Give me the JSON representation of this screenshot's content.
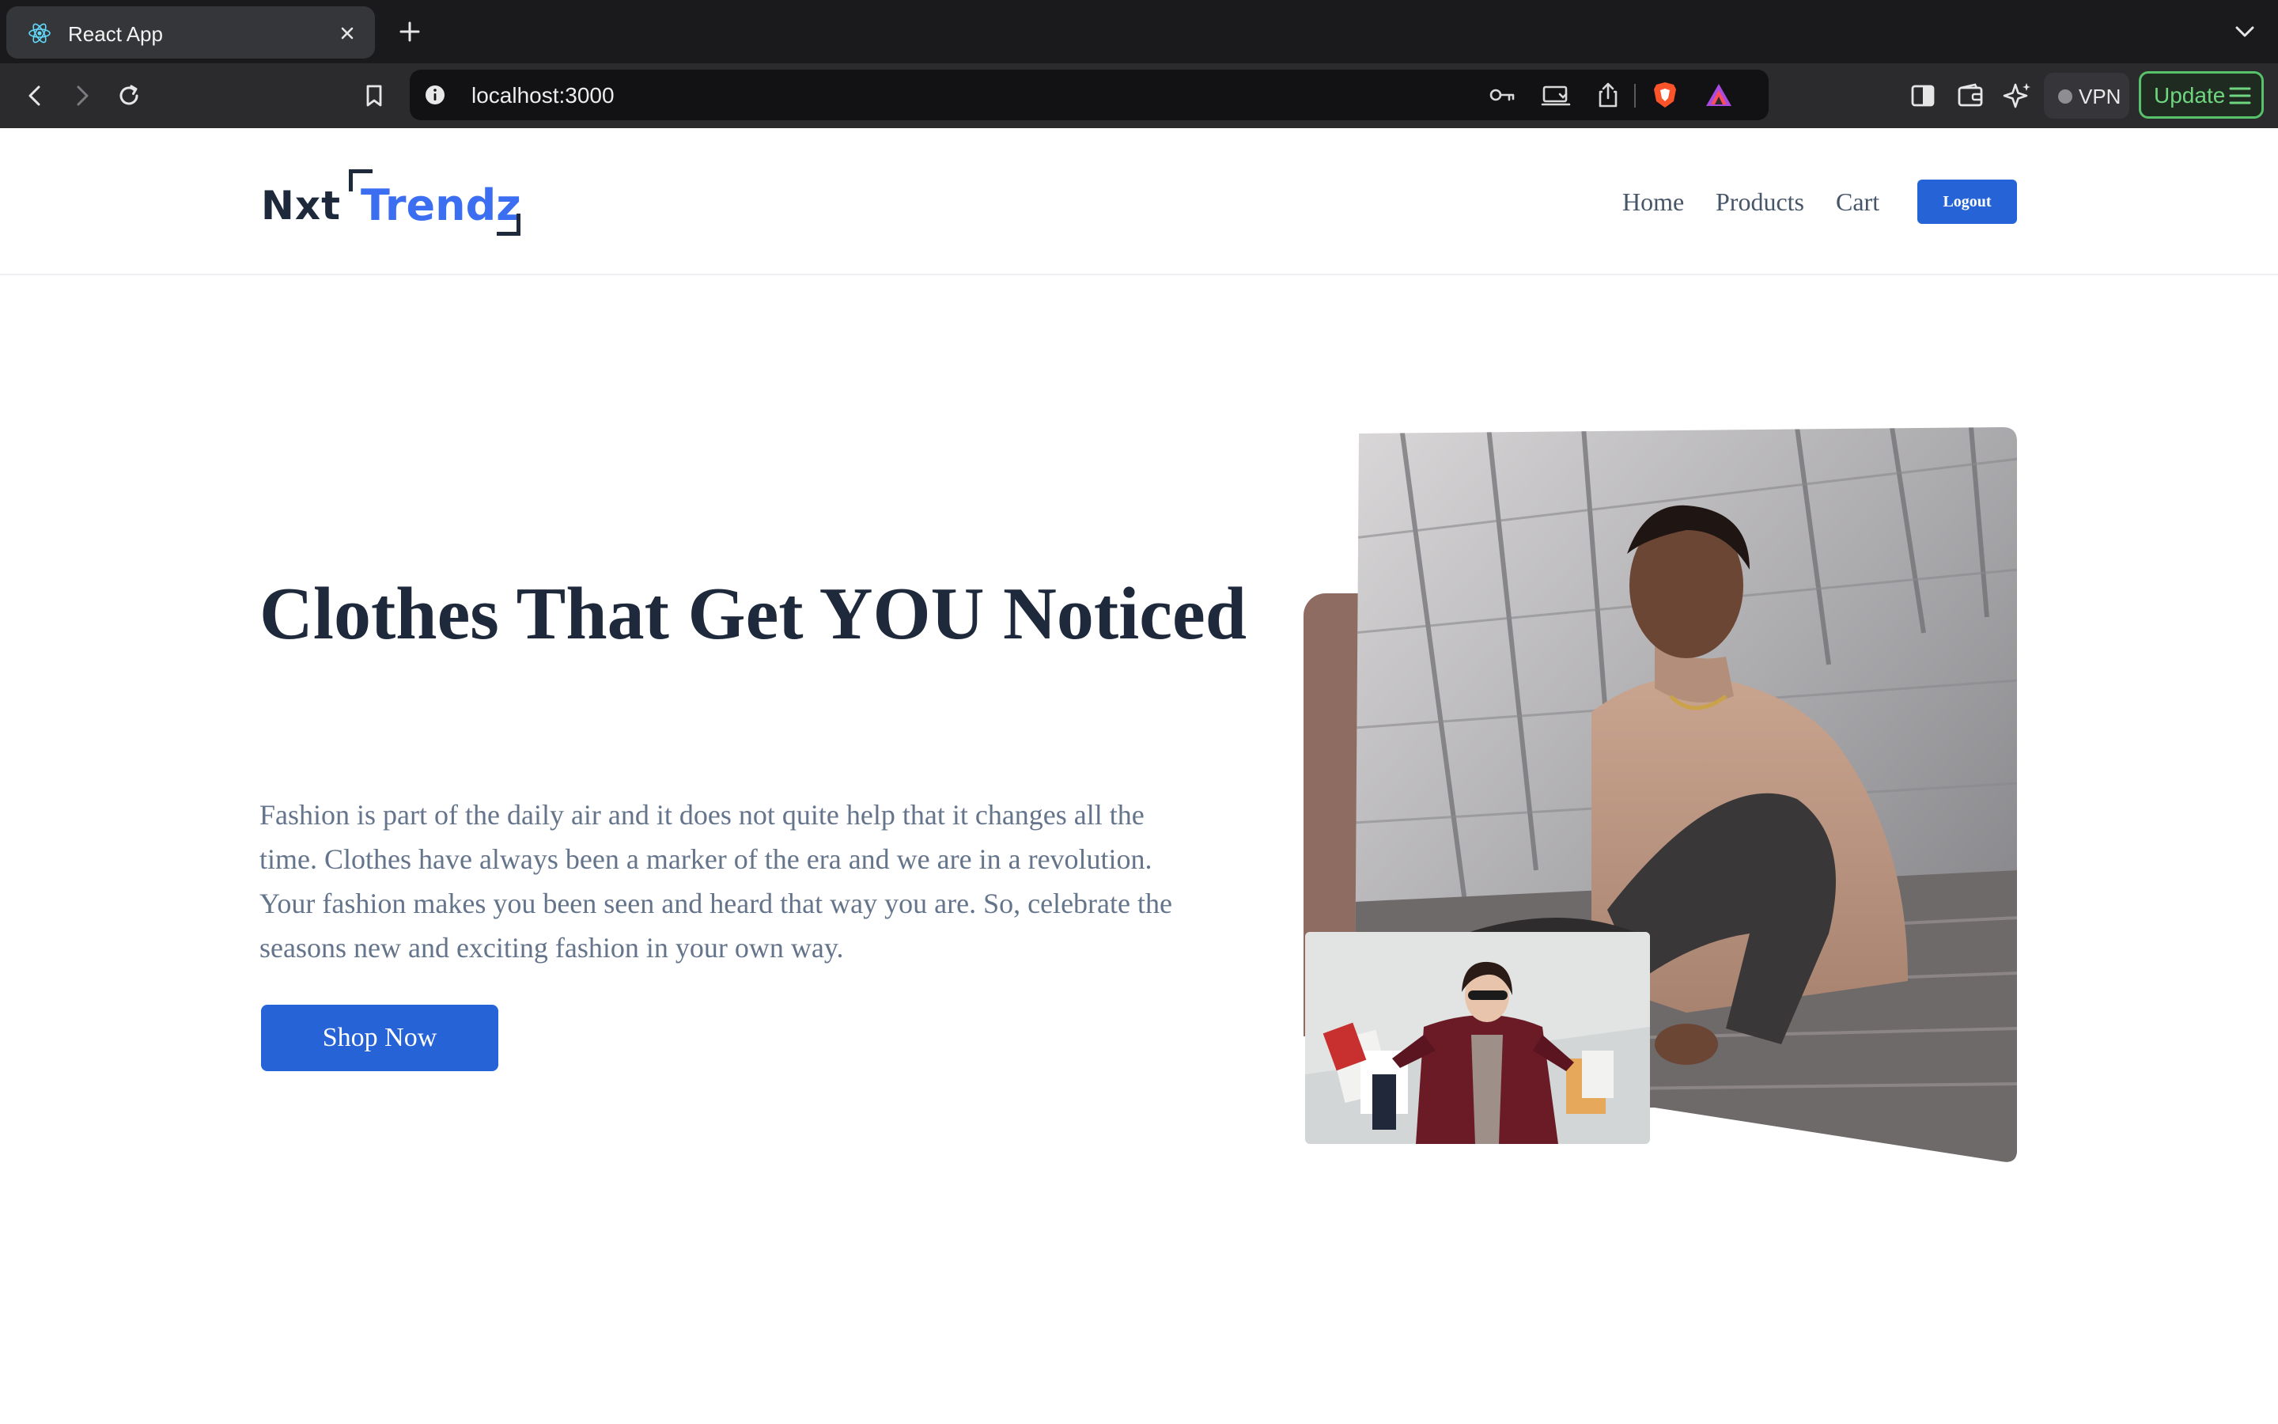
{
  "browser": {
    "tab_title": "React App",
    "url": "localhost:3000",
    "vpn_label": "VPN",
    "update_label": "Update"
  },
  "site": {
    "logo_part1": "Nxt",
    "logo_part2": "Trendz",
    "nav": {
      "home": "Home",
      "products": "Products",
      "cart": "Cart",
      "logout": "Logout"
    }
  },
  "hero": {
    "title": "Clothes That Get YOU Noticed",
    "description": "Fashion is part of the daily air and it does not quite help that it changes all the time. Clothes have always been a marker of the era and we are in a revolution. Your fashion makes you been seen and heard that way you are. So, celebrate the seasons new and exciting fashion in your own way.",
    "cta": "Shop Now"
  },
  "colors": {
    "primary": "#2563d6",
    "logo_accent": "#3b6ef0",
    "heading": "#1e293b",
    "body_text": "#64748b",
    "update_green": "#57c26b"
  }
}
